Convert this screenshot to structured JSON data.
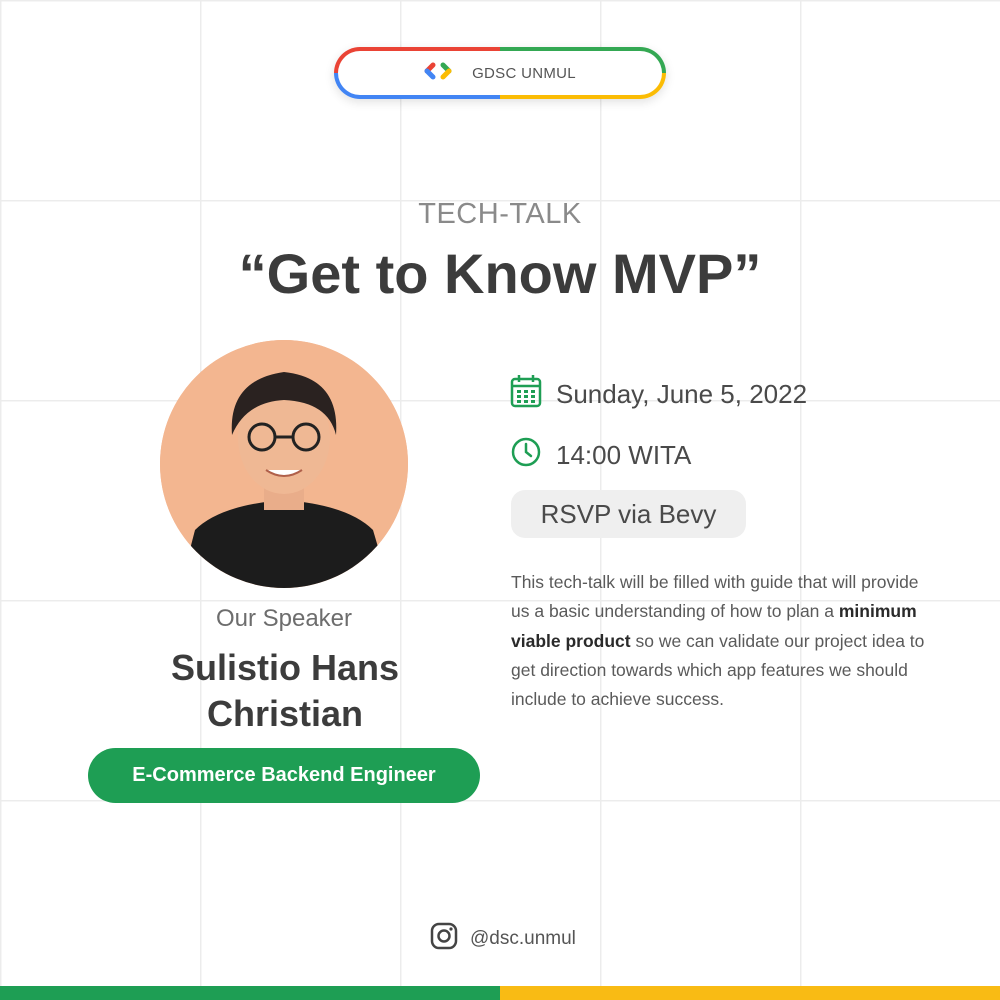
{
  "header": {
    "logo_text": "GDSC UNMUL"
  },
  "event": {
    "eyebrow": "TECH-TALK",
    "title": "“Get to Know MVP”"
  },
  "speaker": {
    "caption": "Our Speaker",
    "name_line1": "Sulistio Hans",
    "name_line2": "Christian",
    "role": "E-Commerce Backend Engineer"
  },
  "details": {
    "date": "Sunday, June 5, 2022",
    "time": "14:00 WITA",
    "rsvp_label": "RSVP via Bevy",
    "description_before": "This tech-talk will be filled with guide that will provide us a basic understanding of how to plan a ",
    "description_bold": "minimum viable product",
    "description_after": " so we can validate our project idea to get direction towards which app features we should include to achieve success."
  },
  "footer": {
    "instagram_handle": "@dsc.unmul"
  },
  "colors": {
    "google_red": "#ea4335",
    "google_blue": "#4285f4",
    "google_green": "#34a853",
    "google_yellow": "#fbbc04",
    "badge_green": "#1e9e54",
    "text_dark": "#3c3c3c"
  },
  "icons": [
    "gdsc-logo-icon",
    "calendar-icon",
    "clock-icon",
    "instagram-icon"
  ]
}
